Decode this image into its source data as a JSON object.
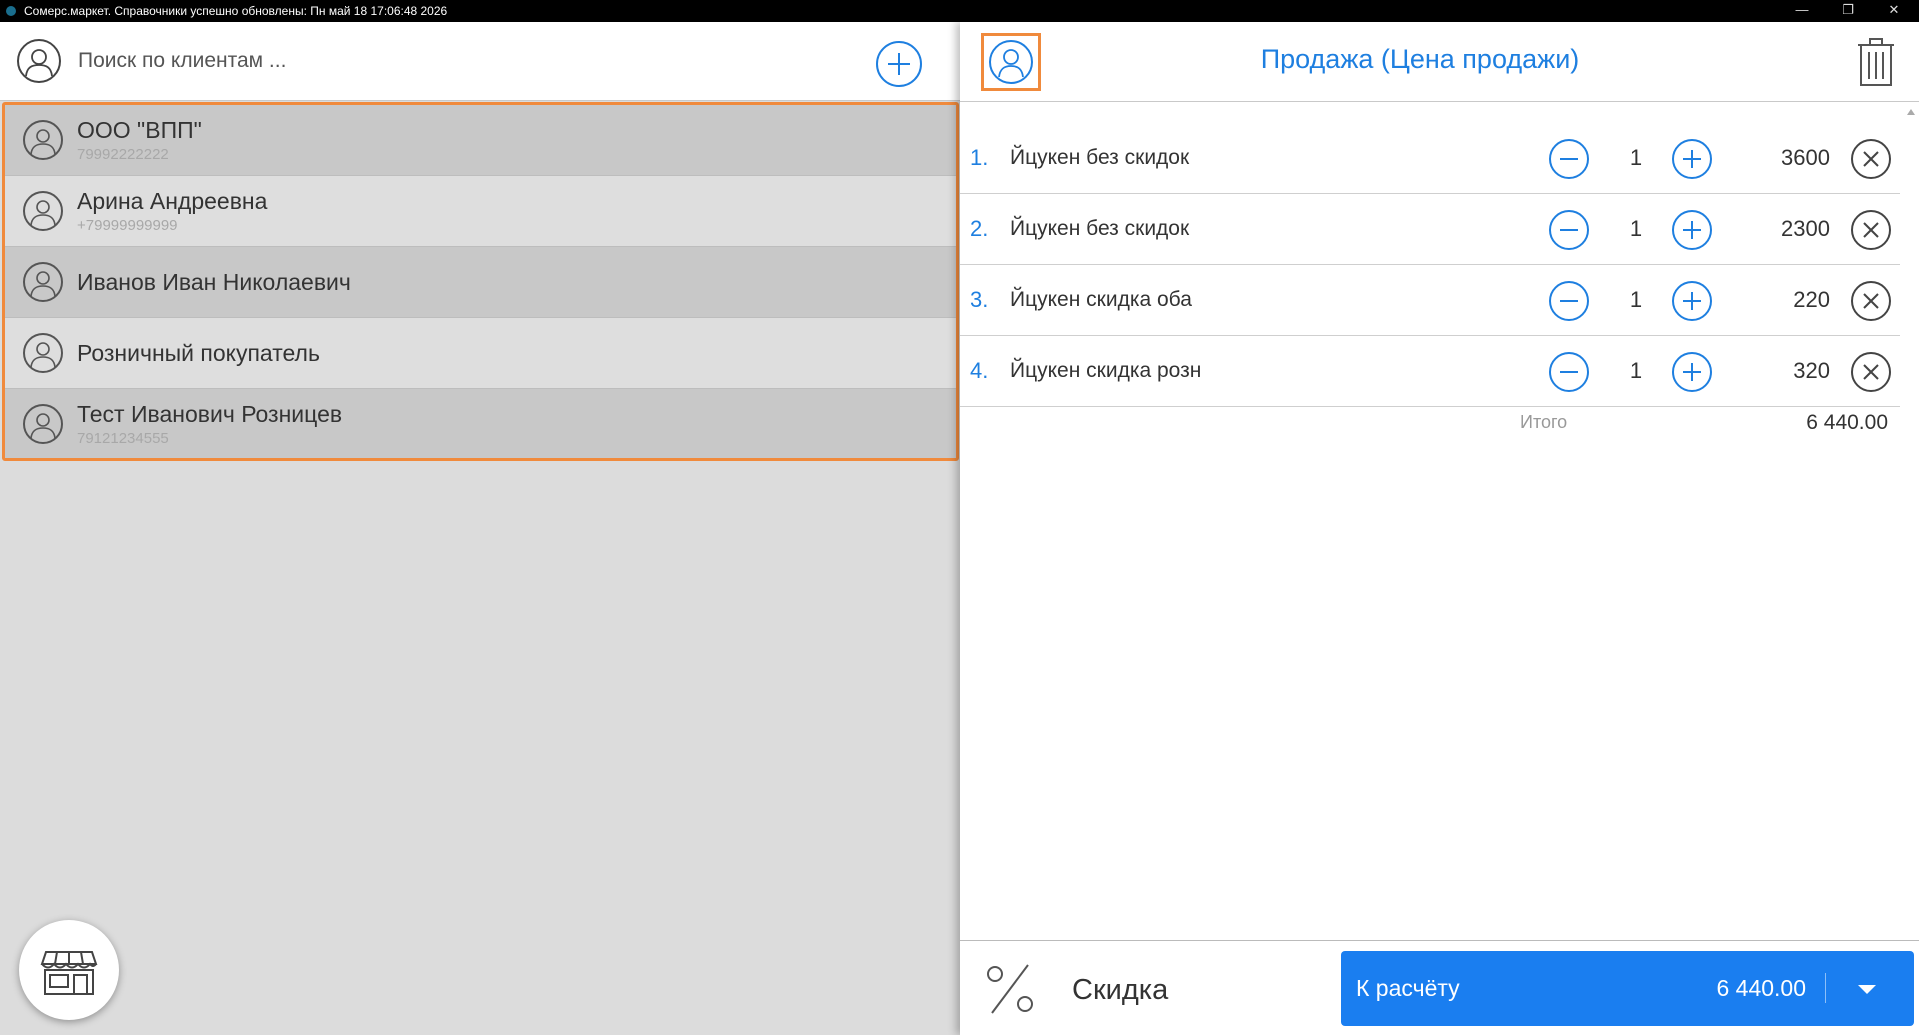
{
  "window": {
    "title": "Сомерс.маркет. Справочники успешно обновлены: Пн май 18 17:06:48 2026"
  },
  "clients_panel": {
    "search_placeholder": "Поиск по клиентам ...",
    "clients": [
      {
        "name": "ООО \"ВПП\"",
        "phone": "79992222222"
      },
      {
        "name": "Арина Андреевна",
        "phone": "+79999999999"
      },
      {
        "name": "Иванов Иван Николаевич",
        "phone": ""
      },
      {
        "name": "Розничный покупатель",
        "phone": ""
      },
      {
        "name": "Тест Иванович Розницев",
        "phone": "79121234555"
      }
    ]
  },
  "sale_panel": {
    "title": "Продажа (Цена продажи)",
    "items": [
      {
        "num": "1.",
        "name": "Йцукен без скидок",
        "qty": "1",
        "price": "3600"
      },
      {
        "num": "2.",
        "name": "Йцукен без скидок",
        "qty": "1",
        "price": "2300"
      },
      {
        "num": "3.",
        "name": "Йцукен скидка оба",
        "qty": "1",
        "price": "220"
      },
      {
        "num": "4.",
        "name": "Йцукен скидка розн",
        "qty": "1",
        "price": "320"
      }
    ],
    "total_label": "Итого",
    "total_value": "6 440.00",
    "discount_label": "Скидка",
    "pay_label": "К расчёту",
    "pay_amount": "6 440.00"
  },
  "colors": {
    "accent": "#1e7fe0",
    "highlight": "#f08a3c",
    "pay_button": "#1a7ef0"
  },
  "icons": {
    "client": "user-icon",
    "add": "plus-circle-icon",
    "trash": "trash-icon",
    "decrease": "minus-circle-icon",
    "increase": "plus-circle-icon",
    "remove": "close-circle-icon",
    "discount": "percent-icon",
    "store": "store-icon",
    "dropdown": "chevron-down-icon"
  }
}
